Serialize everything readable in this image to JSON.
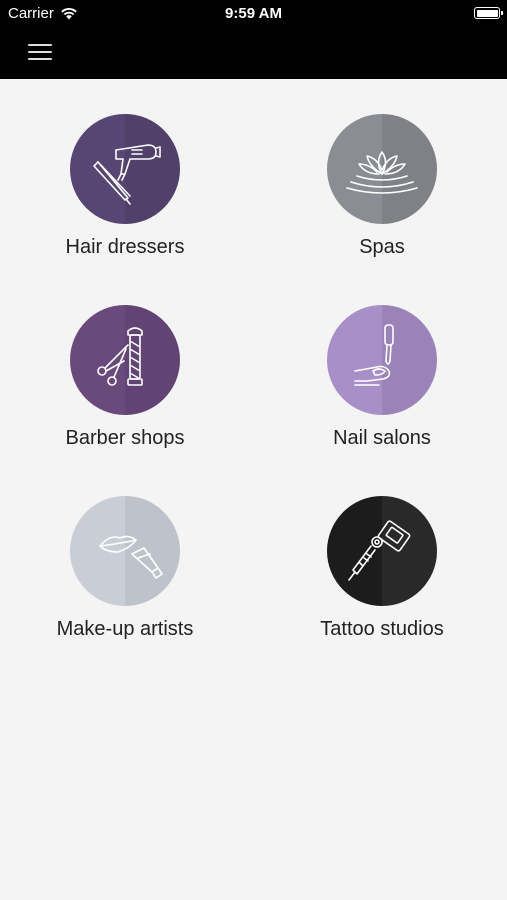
{
  "status_bar": {
    "carrier": "Carrier",
    "time": "9:59 AM"
  },
  "nav": {
    "menu_icon": "hamburger-menu-icon"
  },
  "categories": [
    {
      "label": "Hair dressers",
      "icon": "hair-dryer-icon",
      "color": "#574673"
    },
    {
      "label": "Spas",
      "icon": "lotus-icon",
      "color": "#8a8d93"
    },
    {
      "label": "Barber shops",
      "icon": "barber-pole-icon",
      "color": "#6a4a7d"
    },
    {
      "label": "Nail salons",
      "icon": "nail-polish-icon",
      "color": "#a98fc7"
    },
    {
      "label": "Make-up artists",
      "icon": "lipstick-icon",
      "color": "#c9cdd6"
    },
    {
      "label": "Tattoo studios",
      "icon": "tattoo-machine-icon",
      "color": "#1c1c1c"
    }
  ]
}
